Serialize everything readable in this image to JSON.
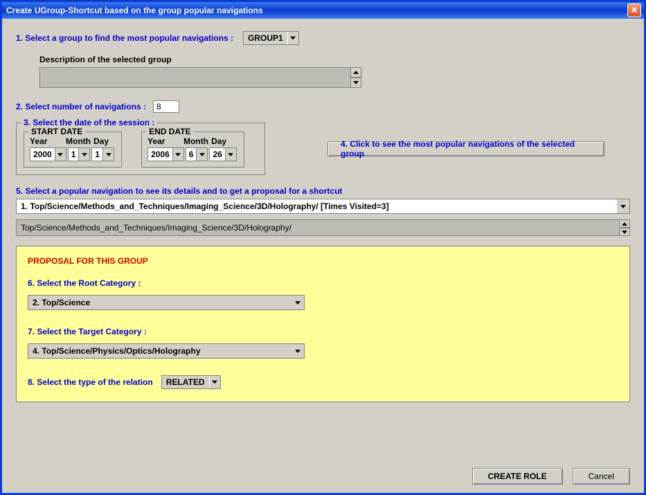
{
  "window": {
    "title": "Create UGroup-Shortcut based on the group popular navigations"
  },
  "step1": {
    "label": "1. Select a group to find the most popular navigations :",
    "selected": "GROUP1"
  },
  "description": {
    "label": "Description of the selected group",
    "value": ""
  },
  "step2": {
    "label": "2. Select number of navigations :",
    "value": "8"
  },
  "step3": {
    "label": "3. Select the date of the session :",
    "start": {
      "title": "START DATE",
      "yearLabel": "Year",
      "monthLabel": "Month",
      "dayLabel": "Day",
      "year": "2000",
      "month": "1",
      "day": "1"
    },
    "end": {
      "title": "END DATE",
      "yearLabel": "Year",
      "monthLabel": "Month",
      "dayLabel": "Day",
      "year": "2006",
      "month": "6",
      "day": "26"
    }
  },
  "step4": {
    "label": "4. Click to see the most popular navigations of the selected group"
  },
  "step5": {
    "label": "5. Select a popular navigation to see its details and to get a proposal for a shortcut",
    "selected": "1. Top/Science/Methods_and_Techniques/Imaging_Science/3D/Holography/ [Times Visited=3]",
    "path": "Top/Science/Methods_and_Techniques/Imaging_Science/3D/Holography/"
  },
  "proposal": {
    "title": "PROPOSAL FOR THIS GROUP",
    "step6": {
      "label": "6. Select the Root Category :",
      "selected": "2. Top/Science"
    },
    "step7": {
      "label": "7. Select the Target Category :",
      "selected": "4. Top/Science/Physics/Optics/Holography"
    },
    "step8": {
      "label": "8. Select the type of the relation",
      "selected": "RELATED"
    }
  },
  "footer": {
    "create": "CREATE ROLE",
    "cancel": "Cancel"
  }
}
